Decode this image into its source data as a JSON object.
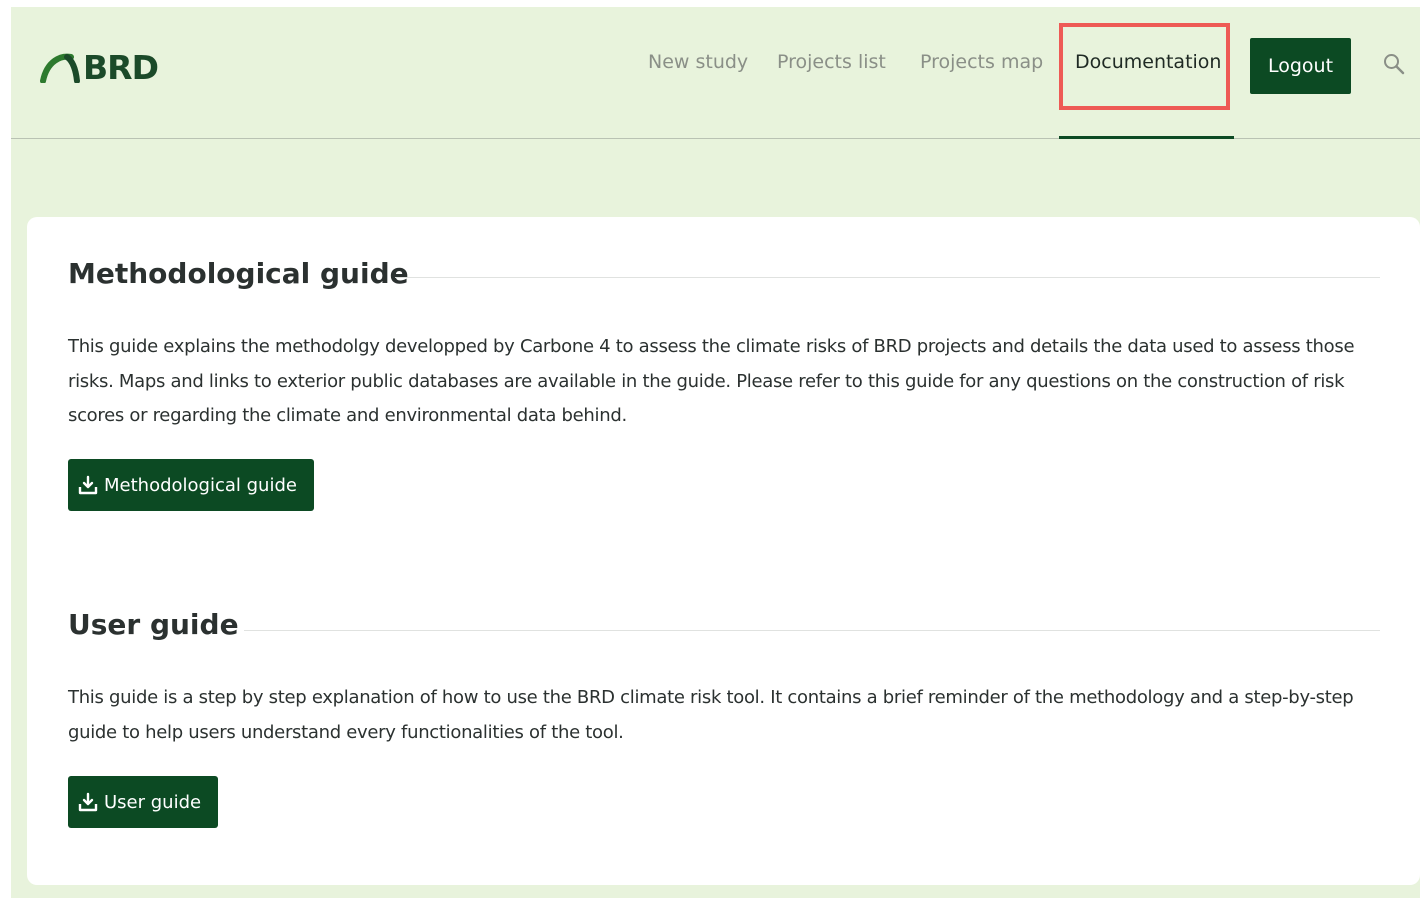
{
  "header": {
    "logo_text": "BRD",
    "nav": {
      "new_study": "New study",
      "projects_list": "Projects list",
      "projects_map": "Projects map",
      "documentation": "Documentation"
    },
    "logout_label": "Logout",
    "icons": {
      "logo": "arch-logo-icon",
      "search": "search-icon"
    }
  },
  "methodological": {
    "title": "Methodological guide",
    "description": "This guide explains the methodolgy developped by Carbone 4 to assess the climate risks of BRD projects and details the data used to assess those risks. Maps and links to exterior public databases are available in the guide. Please refer to this guide for any questions on the construction of risk scores or regarding the climate and environmental data behind.",
    "button_label": "Methodological guide"
  },
  "user": {
    "title": "User guide",
    "description": "This guide is a step by step explanation of how to use the BRD climate risk tool. It contains a brief reminder of the methodology and a step-by-step guide to help users understand every functionalities of the tool.",
    "button_label": "User guide"
  },
  "colors": {
    "page_bg": "#e8f3dc",
    "brand_green": "#0c4a23",
    "highlight": "#ee5a55",
    "nav_inactive": "#8a8f87"
  }
}
